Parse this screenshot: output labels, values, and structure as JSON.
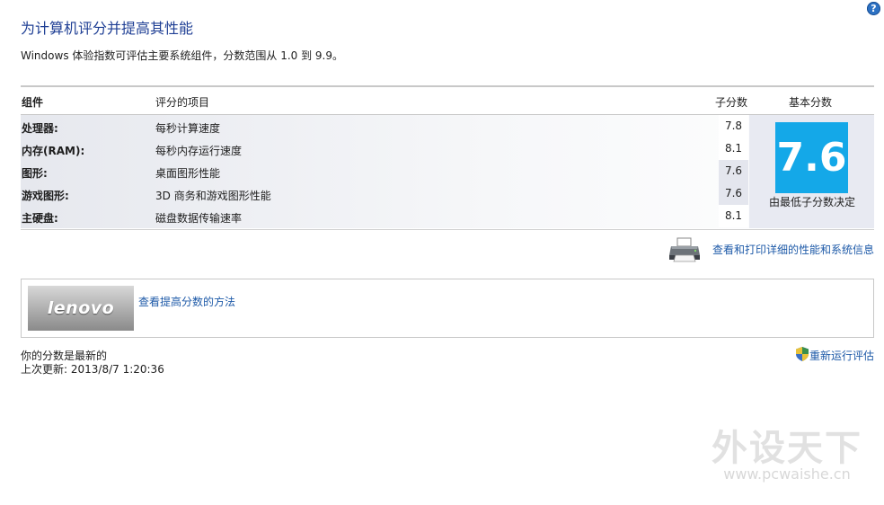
{
  "header": {
    "title": "为计算机评分并提高其性能",
    "description": "Windows 体验指数可评估主要系统组件，分数范围从 1.0 到 9.9。",
    "help_label": "?"
  },
  "table": {
    "columns": {
      "component": "组件",
      "rated_item": "评分的项目",
      "subscore": "子分数",
      "base_score": "基本分数"
    },
    "rows": [
      {
        "component": "处理器:",
        "item": "每秒计算速度",
        "subscore": "7.8"
      },
      {
        "component": "内存(RAM):",
        "item": "每秒内存运行速度",
        "subscore": "8.1"
      },
      {
        "component": "图形:",
        "item": "桌面图形性能",
        "subscore": "7.6"
      },
      {
        "component": "游戏图形:",
        "item": "3D 商务和游戏图形性能",
        "subscore": "7.6"
      },
      {
        "component": "主硬盘:",
        "item": "磁盘数据传输速率",
        "subscore": "8.1"
      }
    ],
    "base_score": "7.6",
    "base_caption": "由最低子分数决定"
  },
  "print_link": "查看和打印详细的性能和系统信息",
  "promo": {
    "logo_text": "lenovo",
    "link": "查看提高分数的方法"
  },
  "status": {
    "text": "你的分数是最新的",
    "last_update": "上次更新: 2013/8/7 1:20:36",
    "rerun_link": "重新运行评估"
  },
  "watermark": {
    "main": "外设天下",
    "url": "www.pcwaishe.cn"
  },
  "colors": {
    "title": "#1e3e94",
    "link": "#1e5aa8",
    "score_tile": "#14a8e8"
  }
}
